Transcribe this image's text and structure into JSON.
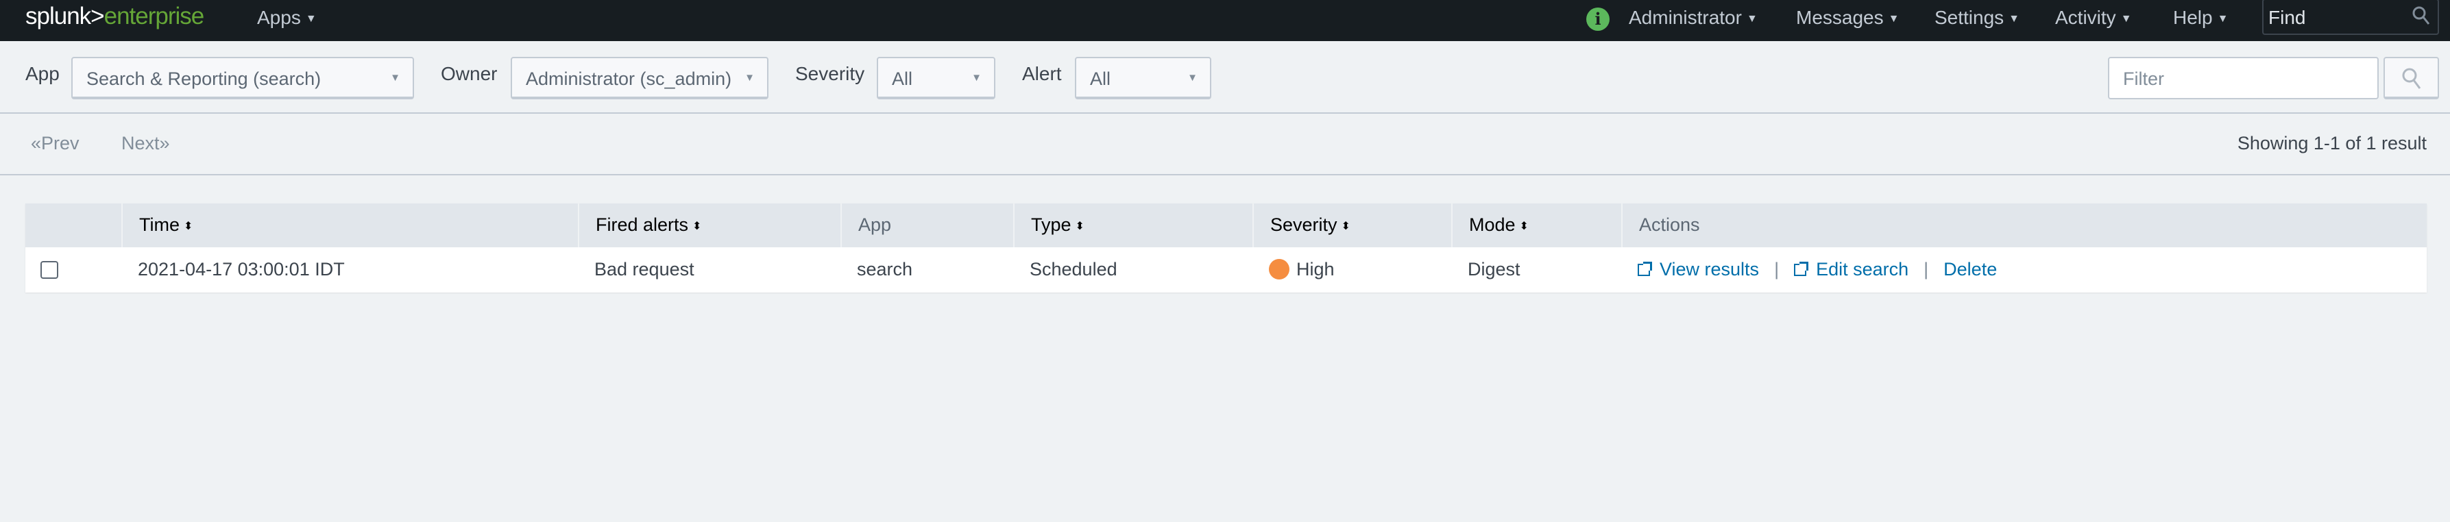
{
  "topbar": {
    "logo_left": "splunk>",
    "logo_right": "enterprise",
    "apps": "Apps",
    "user": "Administrator",
    "messages": "Messages",
    "settings": "Settings",
    "activity": "Activity",
    "help": "Help",
    "find_placeholder": "Find",
    "info_icon": "i"
  },
  "filters": {
    "app_label": "App",
    "app_value": "Search & Reporting (search)",
    "owner_label": "Owner",
    "owner_value": "Administrator (sc_admin)",
    "severity_label": "Severity",
    "severity_value": "All",
    "alert_label": "Alert",
    "alert_value": "All",
    "filter_placeholder": "Filter"
  },
  "pager": {
    "prev": "«Prev",
    "next": "Next»",
    "showing": "Showing 1-1 of 1 result"
  },
  "table": {
    "headers": [
      "Time",
      "Fired alerts",
      "App",
      "Type",
      "Severity",
      "Mode",
      "Actions"
    ],
    "rows": [
      {
        "time": "2021-04-17 03:00:01 IDT",
        "fired_alert": "Bad request",
        "app": "search",
        "type": "Scheduled",
        "severity": "High",
        "severity_color": "#f58d40",
        "mode": "Digest",
        "actions": [
          "View results",
          "Edit search",
          "Delete"
        ]
      }
    ]
  },
  "colors": {
    "accent_link": "#006eaa",
    "brand_green": "#65a637",
    "topbar": "#171d21"
  }
}
